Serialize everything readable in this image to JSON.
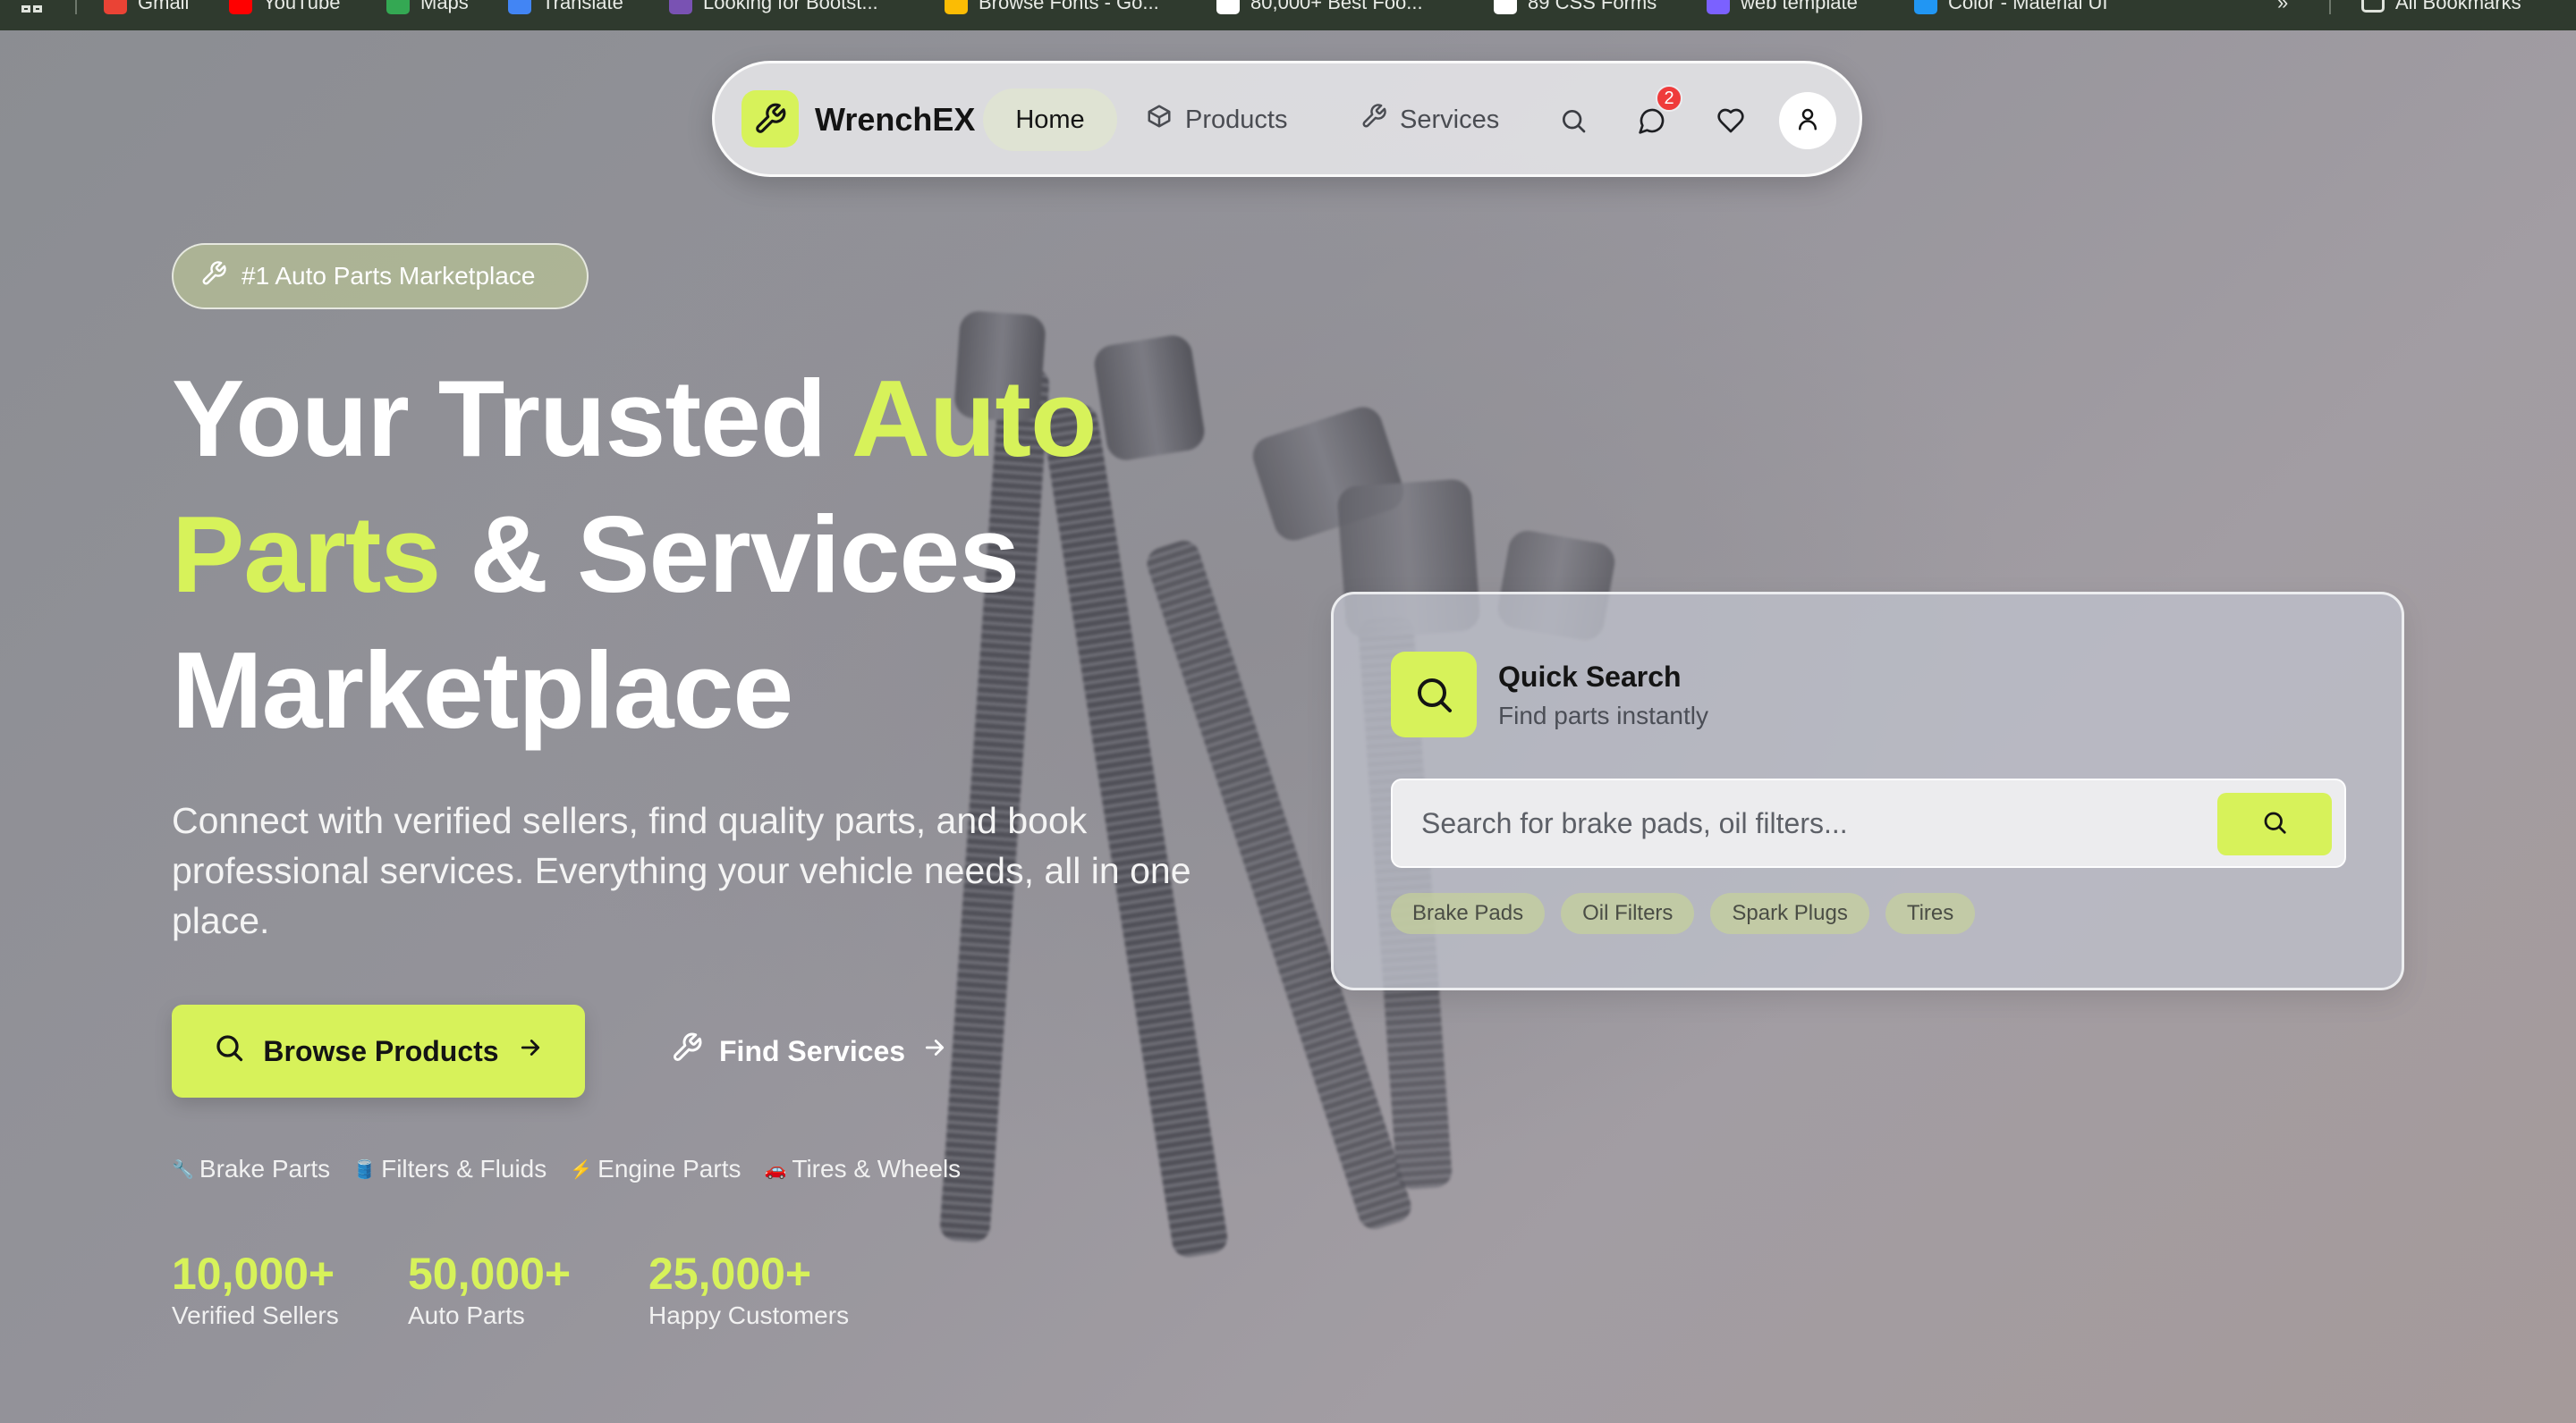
{
  "bookmarks": [
    {
      "label": "Gmail",
      "icon": "gmail-icon",
      "color": "#ea4335"
    },
    {
      "label": "YouTube",
      "icon": "youtube-icon",
      "color": "#ff0000"
    },
    {
      "label": "Maps",
      "icon": "maps-icon",
      "color": "#34a853"
    },
    {
      "label": "Translate",
      "icon": "translate-icon",
      "color": "#4285f4"
    },
    {
      "label": "Looking for Bootst...",
      "icon": "bootstrap-icon",
      "color": "#7952b3"
    },
    {
      "label": "Browse Fonts - Go...",
      "icon": "google-fonts-icon",
      "color": "#fbbc04"
    },
    {
      "label": "80,000+ Best Foo...",
      "icon": "plus-icon",
      "color": "#ffffff"
    },
    {
      "label": "89 CSS Forms",
      "icon": "freefrontend-icon",
      "color": "#ffffff"
    },
    {
      "label": "web template",
      "icon": "template-icon",
      "color": "#7b61ff"
    },
    {
      "label": "Color - Material UI",
      "icon": "mui-icon",
      "color": "#2196f3"
    }
  ],
  "bookmarks_overflow": "»",
  "all_bookmarks": "All Bookmarks",
  "nav": {
    "brand": "WrenchEX",
    "home": "Home",
    "products": "Products",
    "services": "Services",
    "notification_count": "2"
  },
  "hero": {
    "pill": "#1 Auto Parts Marketplace",
    "headline_1": "Your Trusted ",
    "headline_hl_1": "Auto",
    "headline_hl_2": "Parts",
    "headline_2": " & Services",
    "headline_3": "Marketplace",
    "subtitle": "Connect with verified sellers, find quality parts, and book professional services. Everything your vehicle needs, all in one place.",
    "browse_button": "Browse Products",
    "services_button": "Find Services",
    "categories": [
      {
        "emoji": "🔧",
        "label": "Brake Parts"
      },
      {
        "emoji": "🛢️",
        "label": "Filters & Fluids"
      },
      {
        "emoji": "⚡",
        "label": "Engine Parts"
      },
      {
        "emoji": "🚗",
        "label": "Tires & Wheels"
      }
    ],
    "stats": [
      {
        "value": "10,000+",
        "label": "Verified Sellers"
      },
      {
        "value": "50,000+",
        "label": "Auto Parts"
      },
      {
        "value": "25,000+",
        "label": "Happy Customers"
      }
    ]
  },
  "quick_search": {
    "title": "Quick Search",
    "subtitle": "Find parts instantly",
    "placeholder": "Search for brake pads, oil filters...",
    "tags": [
      "Brake Pads",
      "Oil Filters",
      "Spark Plugs",
      "Tires"
    ]
  },
  "colors": {
    "accent": "#d7f25a",
    "badge": "#ef3b3b"
  }
}
